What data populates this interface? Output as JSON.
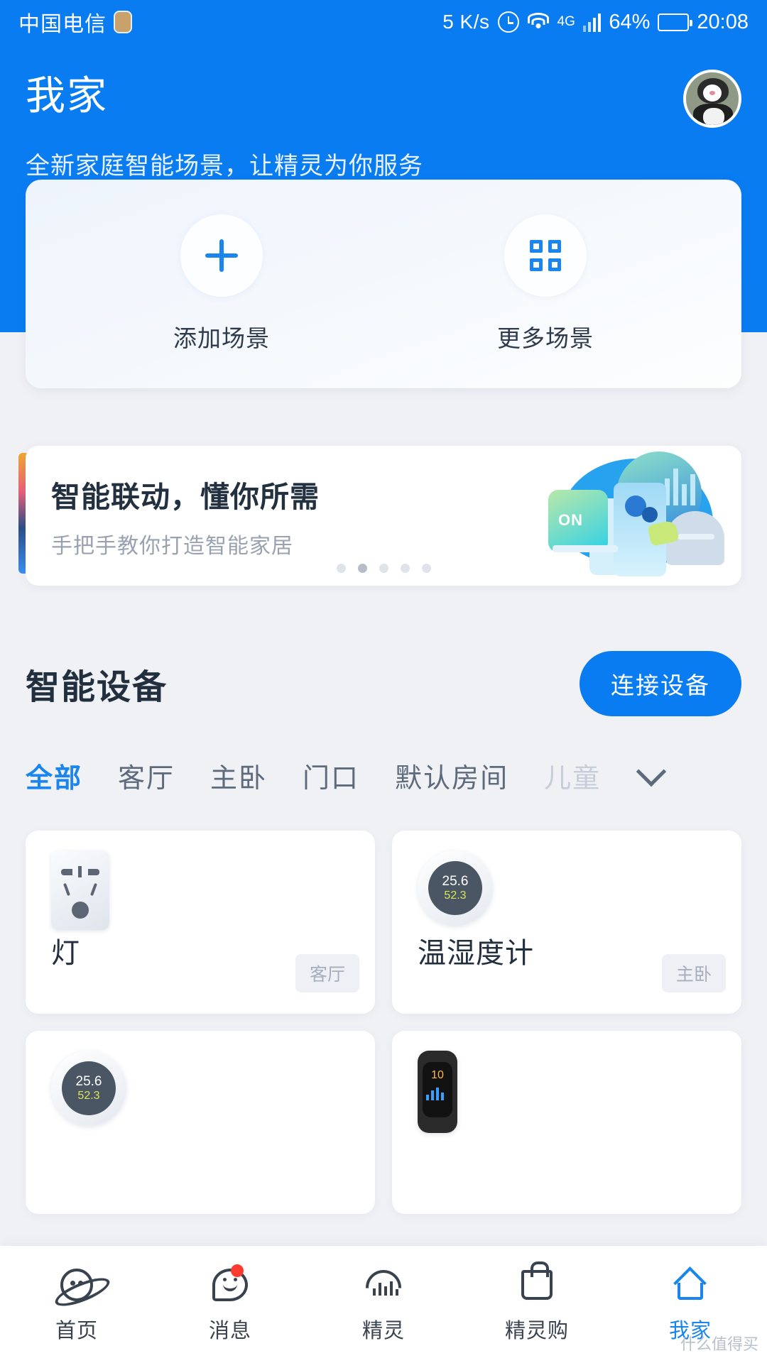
{
  "statusbar": {
    "carrier": "中国电信",
    "network_speed": "5 K/s",
    "network_type": "4G",
    "battery_percent": "64%",
    "time": "20:08"
  },
  "header": {
    "title": "我家",
    "subtitle": "全新家庭智能场景，让精灵为你服务",
    "avatar_alt": "cat-avatar"
  },
  "scene_card": {
    "items": [
      {
        "label": "添加场景",
        "icon": "plus-icon"
      },
      {
        "label": "更多场景",
        "icon": "grid-icon"
      }
    ]
  },
  "banner": {
    "title": "智能联动，懂你所需",
    "subtitle": "手把手教你打造智能家居",
    "dots_total": 5,
    "dots_active_index": 1
  },
  "devices_section": {
    "title": "智能设备",
    "connect_button": "连接设备",
    "tabs": [
      {
        "label": "全部",
        "state": "active"
      },
      {
        "label": "客厅",
        "state": "normal"
      },
      {
        "label": "主卧",
        "state": "normal"
      },
      {
        "label": "门口",
        "state": "normal"
      },
      {
        "label": "默认房间",
        "state": "normal"
      },
      {
        "label": "儿童",
        "state": "faded"
      }
    ],
    "more_tabs_icon": "chevron-down-icon",
    "cards": [
      {
        "name": "灯",
        "room": "客厅",
        "icon": "socket-icon"
      },
      {
        "name": "温湿度计",
        "room": "主卧",
        "icon": "thermo-hygrometer-icon",
        "temperature": "25.6",
        "temperature_unit": "℃",
        "humidity": "52.3"
      },
      {
        "name": "",
        "room": "",
        "icon": "thermo-hygrometer-icon",
        "temperature": "25.6",
        "temperature_unit": "℃",
        "humidity": "52.3"
      },
      {
        "name": "",
        "room": "",
        "icon": "smart-band-icon",
        "band_value": "10"
      }
    ]
  },
  "bottom_nav": {
    "items": [
      {
        "label": "首页",
        "icon": "planet-icon",
        "state": "normal",
        "badge": false
      },
      {
        "label": "消息",
        "icon": "chat-icon",
        "state": "normal",
        "badge": true
      },
      {
        "label": "精灵",
        "icon": "voice-icon",
        "state": "normal",
        "badge": false
      },
      {
        "label": "精灵购",
        "icon": "shopping-bag-icon",
        "state": "normal",
        "badge": false
      },
      {
        "label": "我家",
        "icon": "home-icon",
        "state": "active",
        "badge": false
      }
    ]
  },
  "watermark": "什么值得买",
  "colors": {
    "brand_blue": "#0a7cf2",
    "accent_blue": "#1a85ef",
    "page_bg": "#f0f1f5",
    "badge_red": "#ff3b30"
  }
}
